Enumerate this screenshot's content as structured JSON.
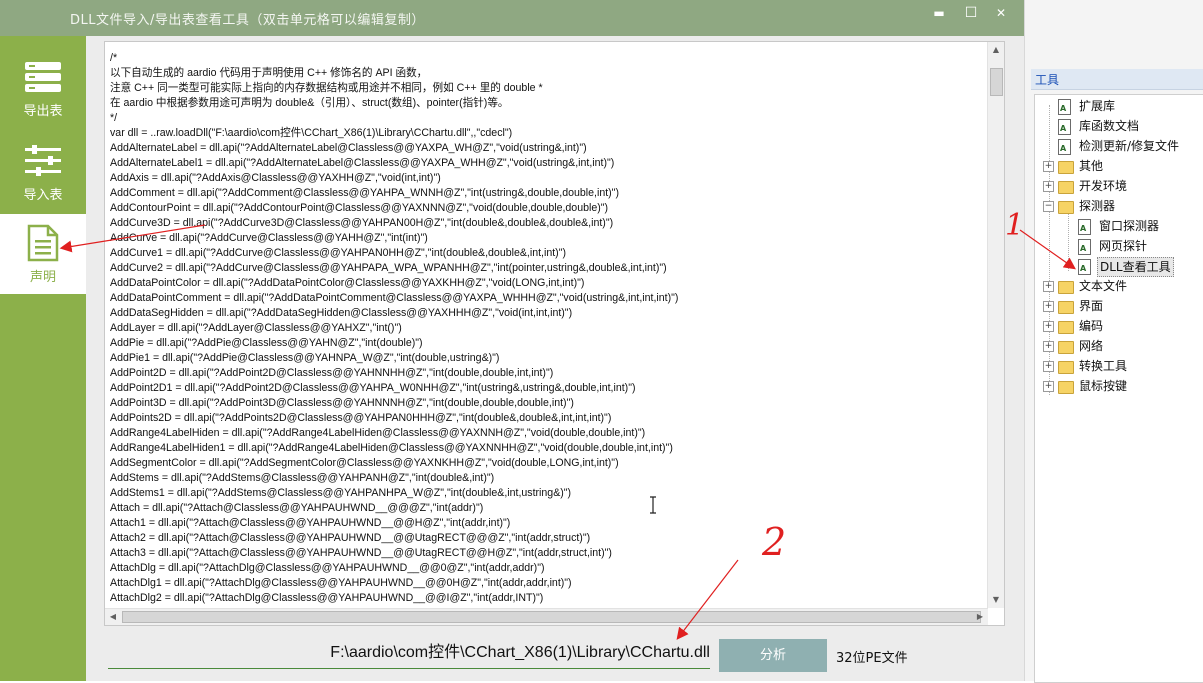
{
  "window": {
    "title": "DLL文件导入/导出表查看工具（双击单元格可以编辑复制）",
    "minimize": "▬",
    "maximize": "☐",
    "close": "✕"
  },
  "sidebar": {
    "items": [
      {
        "label": "导出表",
        "icon": "table-icon"
      },
      {
        "label": "导入表",
        "icon": "sliders-icon"
      },
      {
        "label": "声明",
        "icon": "document-icon"
      }
    ],
    "accent": "#8cb04a"
  },
  "code": {
    "lines": [
      "/*",
      "以下自动生成的 aardio 代码用于声明使用 C++ 修饰名的 API 函数，",
      "注意 C++ 同一类型可能实际上指向的内存数据结构或用途并不相同，例如 C++ 里的 double *",
      "在 aardio 中根据参数用途可声明为 double&（引用）、struct(数组)、pointer(指针)等。",
      "*/",
      "var dll = ..raw.loadDll(\"F:\\aardio\\com控件\\CChart_X86(1)\\Library\\CChartu.dll\",,\"cdecl\")",
      "AddAlternateLabel = dll.api(\"?AddAlternateLabel@Classless@@YAXPA_WH@Z\",\"void(ustring&,int)\")",
      "AddAlternateLabel1 = dll.api(\"?AddAlternateLabel@Classless@@YAXPA_WHH@Z\",\"void(ustring&,int,int)\")",
      "AddAxis = dll.api(\"?AddAxis@Classless@@YAXHH@Z\",\"void(int,int)\")",
      "AddComment = dll.api(\"?AddComment@Classless@@YAHPA_WNNH@Z\",\"int(ustring&,double,double,int)\")",
      "AddContourPoint = dll.api(\"?AddContourPoint@Classless@@YAXNNN@Z\",\"void(double,double,double)\")",
      "AddCurve3D = dll.api(\"?AddCurve3D@Classless@@YAHPAN00H@Z\",\"int(double&,double&,double&,int)\")",
      "AddCurve = dll.api(\"?AddCurve@Classless@@YAHH@Z\",\"int(int)\")",
      "AddCurve1 = dll.api(\"?AddCurve@Classless@@YAHPAN0HH@Z\",\"int(double&,double&,int,int)\")",
      "AddCurve2 = dll.api(\"?AddCurve@Classless@@YAHPAPA_WPA_WPANHH@Z\",\"int(pointer,ustring&,double&,int,int)\")",
      "AddDataPointColor = dll.api(\"?AddDataPointColor@Classless@@YAXKHH@Z\",\"void(LONG,int,int)\")",
      "AddDataPointComment = dll.api(\"?AddDataPointComment@Classless@@YAXPA_WHHH@Z\",\"void(ustring&,int,int,int)\")",
      "AddDataSegHidden = dll.api(\"?AddDataSegHidden@Classless@@YAXHHH@Z\",\"void(int,int,int)\")",
      "AddLayer = dll.api(\"?AddLayer@Classless@@YAHXZ\",\"int()\")",
      "AddPie = dll.api(\"?AddPie@Classless@@YAHN@Z\",\"int(double)\")",
      "AddPie1 = dll.api(\"?AddPie@Classless@@YAHNPA_W@Z\",\"int(double,ustring&)\")",
      "AddPoint2D = dll.api(\"?AddPoint2D@Classless@@YAHNNHH@Z\",\"int(double,double,int,int)\")",
      "AddPoint2D1 = dll.api(\"?AddPoint2D@Classless@@YAHPA_W0NHH@Z\",\"int(ustring&,ustring&,double,int,int)\")",
      "AddPoint3D = dll.api(\"?AddPoint3D@Classless@@YAHNNNH@Z\",\"int(double,double,double,int)\")",
      "AddPoints2D = dll.api(\"?AddPoints2D@Classless@@YAHPAN0HHH@Z\",\"int(double&,double&,int,int,int)\")",
      "AddRange4LabelHiden = dll.api(\"?AddRange4LabelHiden@Classless@@YAXNNH@Z\",\"void(double,double,int)\")",
      "AddRange4LabelHiden1 = dll.api(\"?AddRange4LabelHiden@Classless@@YAXNNHH@Z\",\"void(double,double,int,int)\")",
      "AddSegmentColor = dll.api(\"?AddSegmentColor@Classless@@YAXNKHH@Z\",\"void(double,LONG,int,int)\")",
      "AddStems = dll.api(\"?AddStems@Classless@@YAHPANH@Z\",\"int(double&,int)\")",
      "AddStems1 = dll.api(\"?AddStems@Classless@@YAHPANHPA_W@Z\",\"int(double&,int,ustring&)\")",
      "Attach = dll.api(\"?Attach@Classless@@YAHPAUHWND__@@@Z\",\"int(addr)\")",
      "Attach1 = dll.api(\"?Attach@Classless@@YAHPAUHWND__@@H@Z\",\"int(addr,int)\")",
      "Attach2 = dll.api(\"?Attach@Classless@@YAHPAUHWND__@@UtagRECT@@@Z\",\"int(addr,struct)\")",
      "Attach3 = dll.api(\"?Attach@Classless@@YAHPAUHWND__@@UtagRECT@@H@Z\",\"int(addr,struct,int)\")",
      "AttachDlg = dll.api(\"?AttachDlg@Classless@@YAHPAUHWND__@@0@Z\",\"int(addr,addr)\")",
      "AttachDlg1 = dll.api(\"?AttachDlg@Classless@@YAHPAUHWND__@@0H@Z\",\"int(addr,addr,int)\")",
      "AttachDlg2 = dll.api(\"?AttachDlg@Classless@@YAHPAUHWND__@@I@Z\",\"int(addr,INT)\")"
    ]
  },
  "bottom": {
    "path": "F:\\aardio\\com控件\\CChart_X86(1)\\Library\\CChartu.dll",
    "analyze_label": "分析",
    "pe_type": "32位PE文件"
  },
  "tools_panel": {
    "title": "工具",
    "nodes": [
      {
        "label": "扩展库",
        "kind": "doc",
        "level": 1,
        "expander": ""
      },
      {
        "label": "库函数文档",
        "kind": "doc",
        "level": 1,
        "expander": ""
      },
      {
        "label": "检测更新/修复文件",
        "kind": "doc",
        "level": 1,
        "expander": ""
      },
      {
        "label": "其他",
        "kind": "folder",
        "level": 1,
        "expander": "+"
      },
      {
        "label": "开发环境",
        "kind": "folder",
        "level": 1,
        "expander": "+"
      },
      {
        "label": "探测器",
        "kind": "folder",
        "level": 1,
        "expander": "−"
      },
      {
        "label": "窗口探测器",
        "kind": "doc",
        "level": 2,
        "expander": ""
      },
      {
        "label": "网页探针",
        "kind": "doc",
        "level": 2,
        "expander": ""
      },
      {
        "label": "DLL查看工具",
        "kind": "doc",
        "level": 2,
        "expander": "",
        "selected": true
      },
      {
        "label": "文本文件",
        "kind": "folder",
        "level": 1,
        "expander": "+"
      },
      {
        "label": "界面",
        "kind": "folder",
        "level": 1,
        "expander": "+"
      },
      {
        "label": "编码",
        "kind": "folder",
        "level": 1,
        "expander": "+"
      },
      {
        "label": "网络",
        "kind": "folder",
        "level": 1,
        "expander": "+"
      },
      {
        "label": "转换工具",
        "kind": "folder",
        "level": 1,
        "expander": "+"
      },
      {
        "label": "鼠标按键",
        "kind": "folder",
        "level": 1,
        "expander": "+"
      }
    ]
  },
  "annotations": {
    "mark1": "1",
    "mark2": "2",
    "color": "#e02020"
  }
}
